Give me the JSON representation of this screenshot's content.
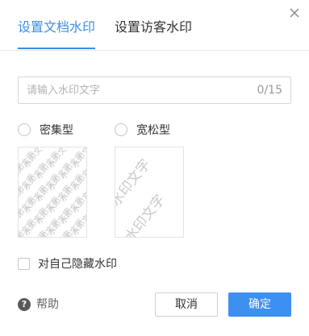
{
  "tabs": [
    {
      "label": "设置文档水印",
      "active": true
    },
    {
      "label": "设置访客水印",
      "active": false
    }
  ],
  "watermark_input": {
    "placeholder": "请输入水印文字",
    "value": "",
    "counter": "0/15"
  },
  "layout_options": [
    {
      "label": "密集型",
      "selected": false
    },
    {
      "label": "宽松型",
      "selected": false
    }
  ],
  "preview_text": "水印文字",
  "hide_for_self": {
    "label": "对自己隐藏水印",
    "checked": false
  },
  "help": {
    "label": "帮助",
    "icon_glyph": "?"
  },
  "buttons": {
    "cancel": "取消",
    "ok": "确定"
  },
  "colors": {
    "accent": "#3a8ee6",
    "primary_button": "#3d8ff0",
    "watermark_text": "#c8c8c8"
  }
}
